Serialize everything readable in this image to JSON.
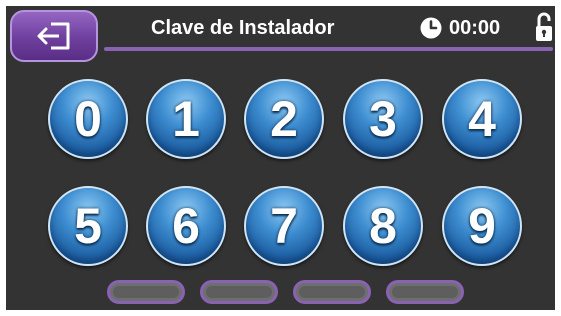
{
  "header": {
    "title": "Clave de Instalador",
    "time": "00:00",
    "back_icon": "exit-icon",
    "clock_icon": "clock-icon",
    "lock_icon": "unlocked-padlock-icon"
  },
  "keypad": {
    "keys": [
      "0",
      "1",
      "2",
      "3",
      "4",
      "5",
      "6",
      "7",
      "8",
      "9"
    ]
  },
  "code_slots": {
    "count": 4,
    "filled": 0
  },
  "colors": {
    "background": "#333333",
    "accent_purple": "#8a62b3",
    "key_blue": "#2f79bd",
    "text": "#ffffff"
  }
}
